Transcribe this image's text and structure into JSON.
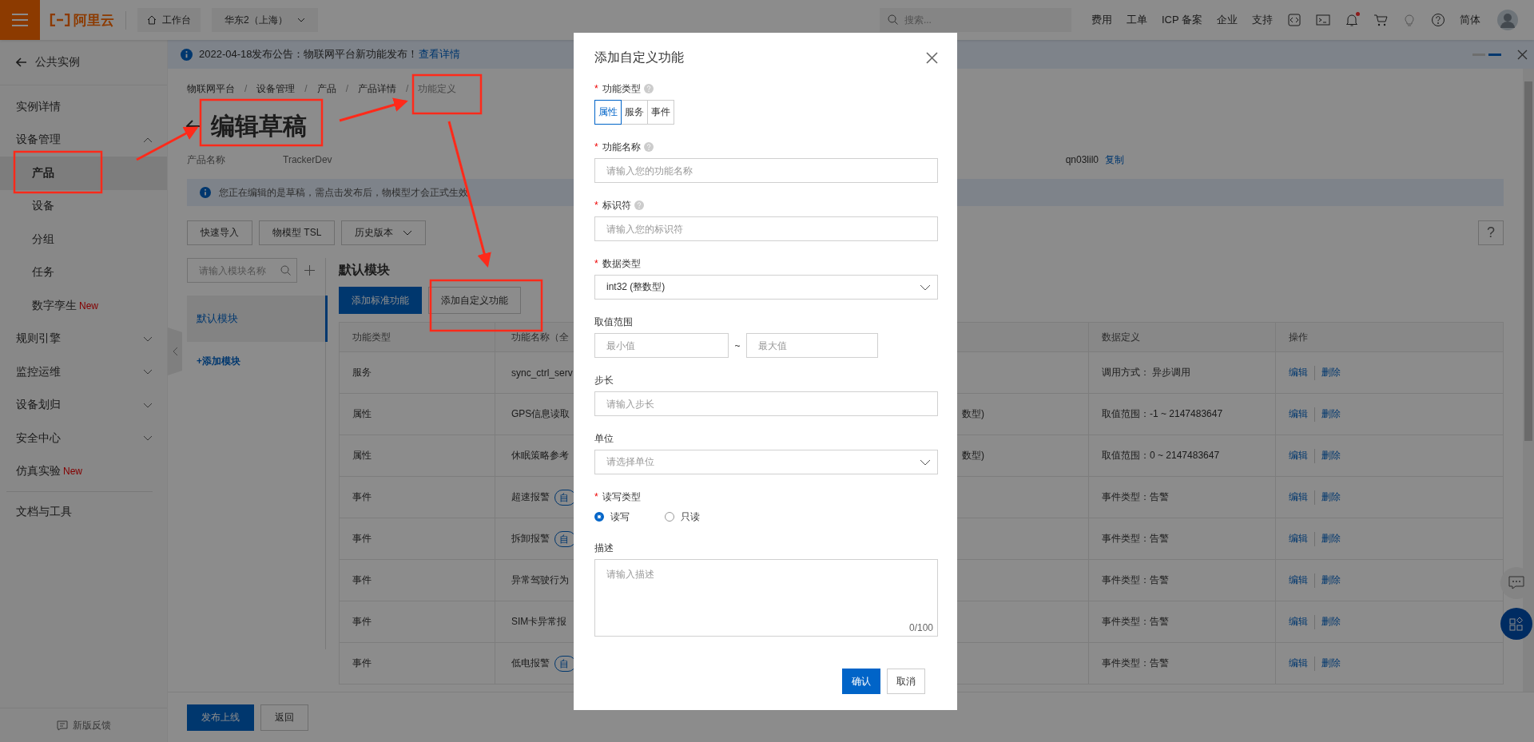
{
  "topbar": {
    "logo": "阿里云",
    "workbench": "工作台",
    "region": "华东2（上海）",
    "search": {
      "placeholder": "搜索..."
    },
    "links": [
      "费用",
      "工单",
      "ICP 备案",
      "企业",
      "支持"
    ],
    "notification_dot": true,
    "language": "简体"
  },
  "sidebar": {
    "back": "公共实例",
    "items": [
      {
        "kind": "item",
        "label": "实例详情",
        "selected": false
      },
      {
        "kind": "group",
        "label": "设备管理",
        "expanded": true,
        "children": [
          {
            "label": "产品",
            "selected": true
          },
          {
            "label": "设备",
            "selected": false
          },
          {
            "label": "分组",
            "selected": false
          },
          {
            "label": "任务",
            "selected": false
          },
          {
            "label": "数字孪生",
            "badge": "New",
            "selected": false
          }
        ]
      },
      {
        "kind": "group",
        "label": "规则引擎",
        "expanded": false
      },
      {
        "kind": "group",
        "label": "监控运维",
        "expanded": false
      },
      {
        "kind": "group",
        "label": "设备划归",
        "expanded": false
      },
      {
        "kind": "group",
        "label": "安全中心",
        "expanded": false
      },
      {
        "kind": "item",
        "label": "仿真实验",
        "badge": "New",
        "selected": false
      },
      {
        "kind": "divider"
      },
      {
        "kind": "item",
        "label": "文档与工具",
        "selected": false
      }
    ],
    "feedback": "新版反馈"
  },
  "announcement": {
    "text": "2022-04-18发布公告：物联网平台新功能发布！",
    "link": "查看详情"
  },
  "breadcrumb": {
    "separator": "/",
    "items": [
      "物联网平台",
      "设备管理",
      "产品",
      "产品详情",
      "功能定义"
    ]
  },
  "page": {
    "title": "编辑草稿",
    "product_label": "产品名称",
    "product_value": "TrackerDev",
    "product_key_tail": "qn03lil0",
    "copy_link": "复制",
    "notice": "您正在编辑的是草稿，需点击发布后，物模型才会正式生效"
  },
  "toolbar": [
    {
      "kind": "button",
      "label": "快速导入"
    },
    {
      "kind": "button",
      "label": "物模型 TSL"
    },
    {
      "kind": "dropdown",
      "label": "历史版本"
    }
  ],
  "help_button": "?",
  "modules": {
    "search": {
      "placeholder": "请输入模块名称"
    },
    "items": [
      {
        "label": "默认模块",
        "selected": true
      }
    ],
    "add": "+添加模块"
  },
  "module_title": "默认模块",
  "actions": [
    {
      "kind": "primary",
      "label": "添加标准功能"
    },
    {
      "kind": "default",
      "label": "添加自定义功能"
    }
  ],
  "table": {
    "columns": {
      "type": "功能类型",
      "name": "功能名称（全",
      "data_definition": "数据定义",
      "actions": "操作"
    },
    "rows": [
      {
        "type": "服务",
        "name": "sync_ctrl_serv",
        "data_definition": "调用方式：  异步调用",
        "actions": [
          "编辑",
          "删除"
        ]
      },
      {
        "type": "属性",
        "name": "GPS信息读取",
        "column_3": "数型)",
        "data_definition": "取值范围：-1 ~ 2147483647",
        "actions": [
          "编辑",
          "删除"
        ]
      },
      {
        "type": "属性",
        "name": "休眠策略参考",
        "column_3": "数型)",
        "data_definition": "取值范围：0 ~ 2147483647",
        "actions": [
          "编辑",
          "删除"
        ]
      },
      {
        "type": "事件",
        "name": "超速报警",
        "tag": "自",
        "data_definition": "事件类型：告警",
        "actions": [
          "编辑",
          "删除"
        ]
      },
      {
        "type": "事件",
        "name": "拆卸报警",
        "tag": "自",
        "data_definition": "事件类型：告警",
        "actions": [
          "编辑",
          "删除"
        ]
      },
      {
        "type": "事件",
        "name": "异常驾驶行为",
        "data_definition": "事件类型：告警",
        "actions": [
          "编辑",
          "删除"
        ]
      },
      {
        "type": "事件",
        "name": "SIM卡异常报",
        "data_definition": "事件类型：告警",
        "actions": [
          "编辑",
          "删除"
        ]
      },
      {
        "type": "事件",
        "name": "低电报警",
        "tag": "自",
        "data_definition": "事件类型：告警",
        "actions": [
          "编辑",
          "删除"
        ]
      }
    ]
  },
  "footer_buttons": [
    {
      "kind": "primary",
      "label": "发布上线"
    },
    {
      "kind": "default",
      "label": "返回"
    }
  ],
  "modal": {
    "title": "添加自定义功能",
    "required_mark": "*",
    "fields": [
      {
        "kind": "segmented",
        "label": "功能类型",
        "required": true,
        "help": true,
        "options": [
          {
            "label": "属性",
            "selected": true
          },
          {
            "label": "服务",
            "selected": false
          },
          {
            "label": "事件",
            "selected": false
          }
        ]
      },
      {
        "kind": "input",
        "label": "功能名称",
        "required": true,
        "help": true,
        "placeholder": "请输入您的功能名称"
      },
      {
        "kind": "input",
        "label": "标识符",
        "required": true,
        "help": true,
        "placeholder": "请输入您的标识符"
      },
      {
        "kind": "select",
        "label": "数据类型",
        "required": true,
        "value": "int32 (整数型)"
      },
      {
        "kind": "range",
        "label": "取值范围",
        "required": false,
        "min_placeholder": "最小值",
        "separator": "~",
        "max_placeholder": "最大值"
      },
      {
        "kind": "input",
        "label": "步长",
        "required": false,
        "placeholder": "请输入步长"
      },
      {
        "kind": "select",
        "label": "单位",
        "required": false,
        "placeholder": "请选择单位"
      },
      {
        "kind": "radio",
        "label": "读写类型",
        "required": true,
        "options": [
          {
            "label": "读写",
            "selected": true
          },
          {
            "label": "只读",
            "selected": false
          }
        ]
      },
      {
        "kind": "textarea",
        "label": "描述",
        "required": false,
        "placeholder": "请输入描述",
        "counter": "0/100"
      }
    ],
    "buttons": [
      {
        "kind": "primary",
        "label": "确认"
      },
      {
        "kind": "default",
        "label": "取消"
      }
    ]
  }
}
